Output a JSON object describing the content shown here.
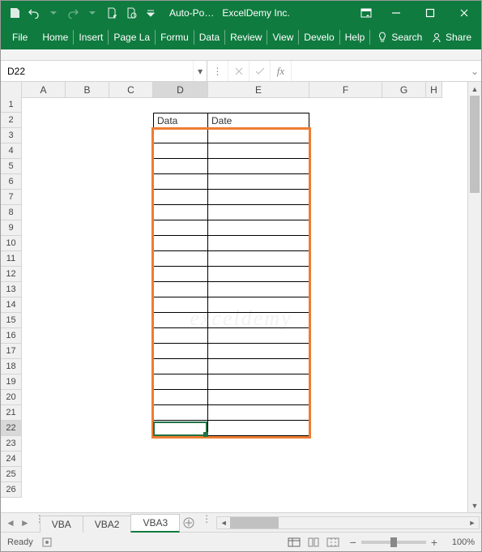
{
  "title": "Auto-Po…",
  "company": "ExcelDemy Inc.",
  "ribbon_tabs": {
    "file": "File",
    "home": "Home",
    "insert": "Insert",
    "page": "Page La",
    "formu": "Formu",
    "data": "Data",
    "review": "Review",
    "view": "View",
    "develo": "Develo",
    "help": "Help"
  },
  "search": {
    "label": "Search"
  },
  "share": {
    "label": "Share"
  },
  "namebox": {
    "value": "D22"
  },
  "columns": [
    "A",
    "B",
    "C",
    "D",
    "E",
    "F",
    "G",
    "H"
  ],
  "rows_count": 26,
  "active_col": "D",
  "active_row": 22,
  "cells": {
    "D2": "Data",
    "E2": "Date"
  },
  "sheet_tabs": {
    "vba": "VBA",
    "vba2": "VBA2",
    "vba3": "VBA3"
  },
  "status": {
    "ready": "Ready"
  },
  "zoom": {
    "level": "100%"
  },
  "watermark": "exceldemy"
}
